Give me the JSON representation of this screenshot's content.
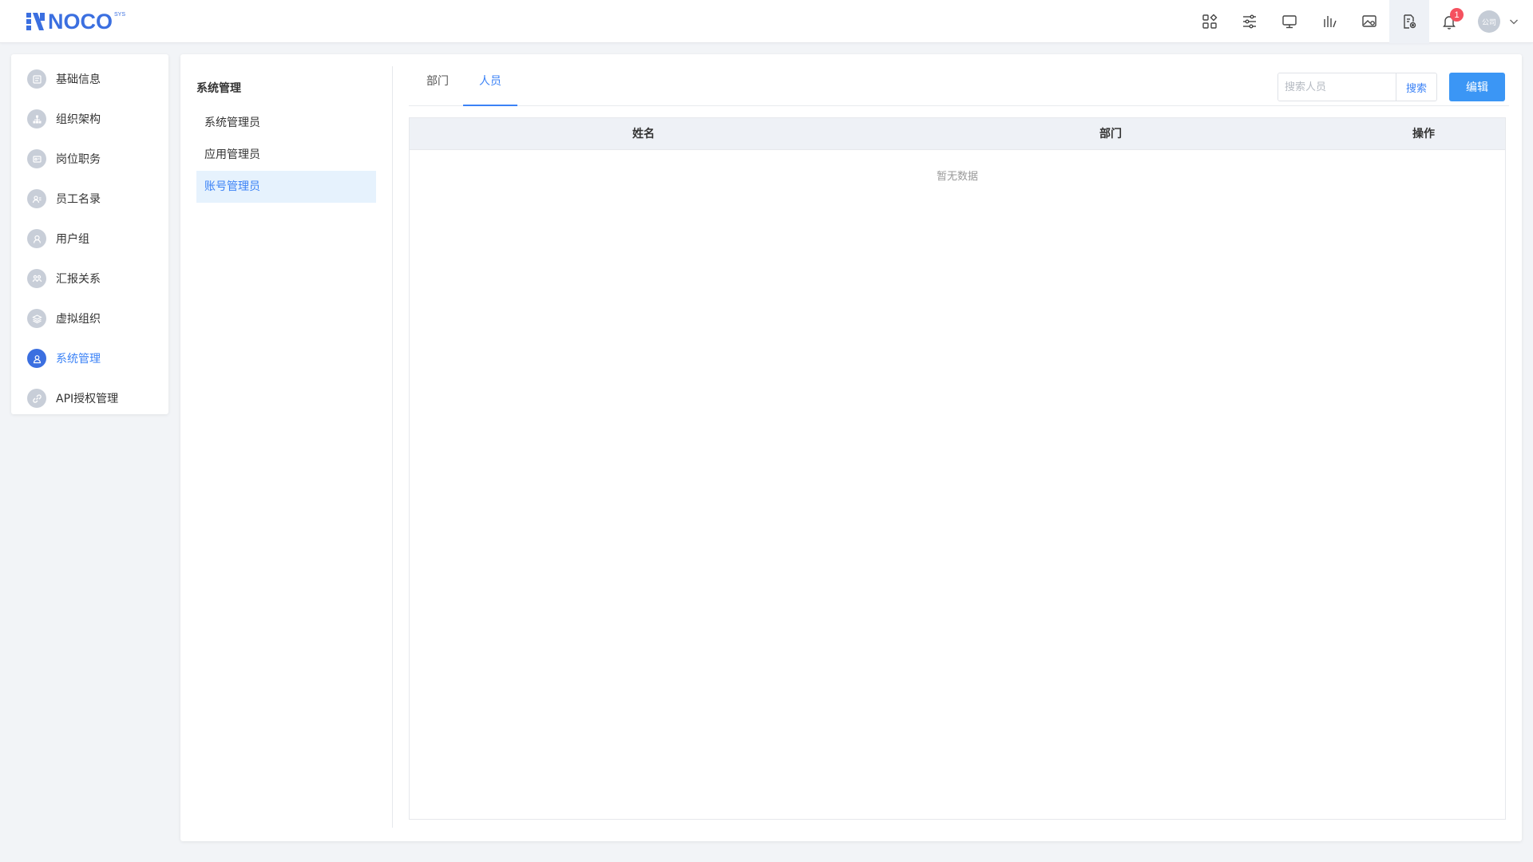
{
  "header": {
    "logo_text": "NOCO",
    "logo_sup": "SYS",
    "tools": [
      {
        "icon": "apps-grid-icon"
      },
      {
        "icon": "sliders-icon"
      },
      {
        "icon": "monitor-icon"
      },
      {
        "icon": "bar-chart-icon"
      },
      {
        "icon": "image-settings-icon"
      },
      {
        "icon": "document-settings-icon"
      },
      {
        "icon": "bell-icon",
        "badge": "1"
      }
    ],
    "avatar_text": "公司"
  },
  "sidenav": {
    "items": [
      {
        "label": "基础信息",
        "icon": "info-card-icon"
      },
      {
        "label": "组织架构",
        "icon": "org-tree-icon"
      },
      {
        "label": "岗位职务",
        "icon": "position-icon"
      },
      {
        "label": "员工名录",
        "icon": "employee-icon"
      },
      {
        "label": "用户组",
        "icon": "user-group-icon"
      },
      {
        "label": "汇报关系",
        "icon": "report-relation-icon"
      },
      {
        "label": "虚拟组织",
        "icon": "layers-icon"
      },
      {
        "label": "系统管理",
        "icon": "admin-icon",
        "active": true
      },
      {
        "label": "API授权管理",
        "icon": "link-icon"
      }
    ]
  },
  "subnav": {
    "title": "系统管理",
    "items": [
      {
        "label": "系统管理员"
      },
      {
        "label": "应用管理员"
      },
      {
        "label": "账号管理员",
        "active": true
      }
    ]
  },
  "tabs": [
    {
      "label": "部门"
    },
    {
      "label": "人员",
      "active": true
    }
  ],
  "search": {
    "placeholder": "搜索人员",
    "value": "",
    "button": "搜索"
  },
  "edit_button": "编辑",
  "table": {
    "columns": [
      "姓名",
      "部门",
      "操作"
    ],
    "empty_text": "暂无数据"
  },
  "colors": {
    "accent": "#3b82f6",
    "primary_button": "#3b96f5",
    "badge": "#f5515f"
  }
}
